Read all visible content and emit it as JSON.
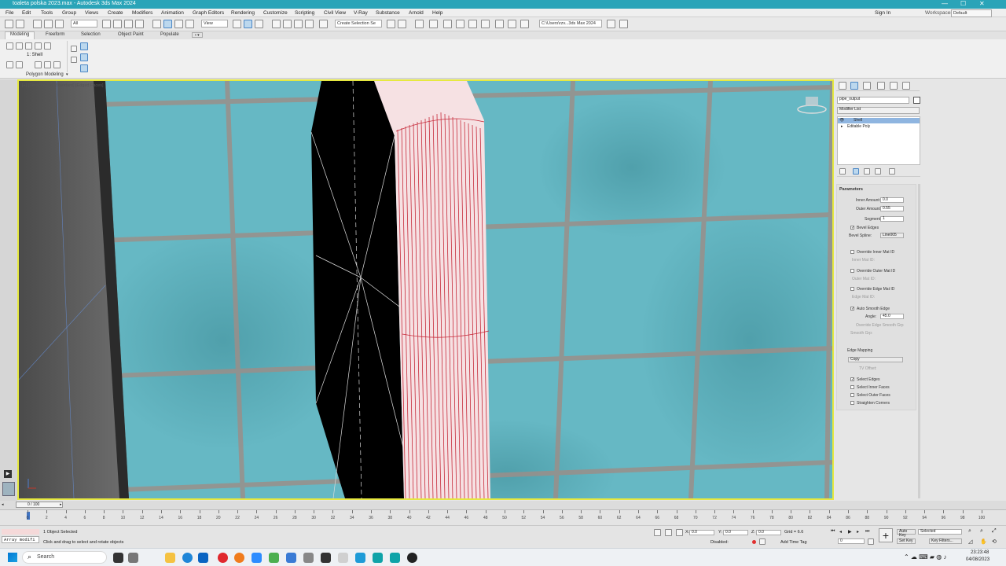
{
  "window": {
    "title": "toaleta polska 2023.max - Autodesk 3ds Max 2024",
    "controls": [
      "—",
      "☐",
      "✕"
    ]
  },
  "menu": {
    "items": [
      "File",
      "Edit",
      "Tools",
      "Group",
      "Views",
      "Create",
      "Modifiers",
      "Animation",
      "Graph Editors",
      "Rendering",
      "Customize",
      "Scripting",
      "Civil View",
      "V-Ray",
      "Substance",
      "Arnold",
      "Help"
    ],
    "sign_in": "Sign In",
    "workspaces_label": "Workspaces:",
    "workspaces_value": "Default"
  },
  "toolbar": {
    "filter": "All",
    "ref_coord": "View",
    "selection_set": "Create Selection Se",
    "project_path": "C:\\Users\\rzv...3ds Max 2024"
  },
  "ribbon": {
    "tabs": [
      "Modeling",
      "Freeform",
      "Selection",
      "Object Paint",
      "Populate"
    ],
    "modifier_label": "1: Shell",
    "panel_label": "Polygon Modeling"
  },
  "viewport": {
    "label": "[+] [Perspective] [Standard] [Edged Faces]"
  },
  "command_panel": {
    "object_name": "pipe_output",
    "modifier_list": "Modifier List",
    "stack": [
      "Shell",
      "Editable Poly"
    ],
    "rollout_title": "Parameters",
    "inner_amount_label": "Inner Amount:",
    "inner_amount": "0.0",
    "outer_amount_label": "Outer Amount:",
    "outer_amount": "0.55",
    "segments_label": "Segments:",
    "segments": "1",
    "bevel_edges": "Bevel Edges",
    "bevel_spline_label": "Bevel Spline:",
    "bevel_spline": "Line005",
    "override_inner": "Override Inner Mat ID",
    "inner_mat_id": "Inner Mat ID:",
    "override_outer": "Override Outer Mat ID",
    "outer_mat_id": "Outer Mat ID:",
    "override_edge": "Override Edge Mat ID",
    "edge_mat_id": "Edge Mat ID:",
    "auto_smooth": "Auto Smooth Edge",
    "angle_label": "Angle:",
    "angle": "45.0",
    "override_edge_smooth": "Override Edge Smooth Grp",
    "smooth_grp": "Smooth Grp:",
    "edge_mapping": "Edge Mapping",
    "mapping_value": "Copy",
    "tv_offset": "TV Offset:",
    "select_edges": "Select Edges",
    "select_inner": "Select Inner Faces",
    "select_outer": "Select Outer Faces",
    "straighten": "Straighten Corners"
  },
  "timeline": {
    "frame": "0 / 100",
    "ticks": [
      "0",
      "2",
      "4",
      "6",
      "8",
      "10",
      "12",
      "14",
      "16",
      "18",
      "20",
      "22",
      "24",
      "26",
      "28",
      "30",
      "32",
      "34",
      "36",
      "38",
      "40",
      "42",
      "44",
      "46",
      "48",
      "50",
      "52",
      "54",
      "56",
      "58",
      "60",
      "62",
      "64",
      "66",
      "68",
      "70",
      "72",
      "74",
      "76",
      "78",
      "80",
      "82",
      "84",
      "86",
      "88",
      "90",
      "92",
      "94",
      "96",
      "98",
      "100"
    ]
  },
  "status": {
    "maxscript": "Array modifi",
    "selected": "1 Object Selected",
    "prompt": "Click and drag to select and rotate objects",
    "x_label": "X:",
    "x": "0.0",
    "y_label": "Y:",
    "y": "0.0",
    "z_label": "Z:",
    "z": "0.0",
    "grid": "Grid = 6.6",
    "disabled": "Disabled:",
    "add_time_tag": "Add Time Tag",
    "auto_key": "Auto Key",
    "set_key": "Set Key",
    "selected_combo": "Selected",
    "key_filters": "Key Filters...",
    "frame_field": "0"
  },
  "taskbar": {
    "search": "Search",
    "time": "23:23:48",
    "date": "04/08/2023"
  }
}
